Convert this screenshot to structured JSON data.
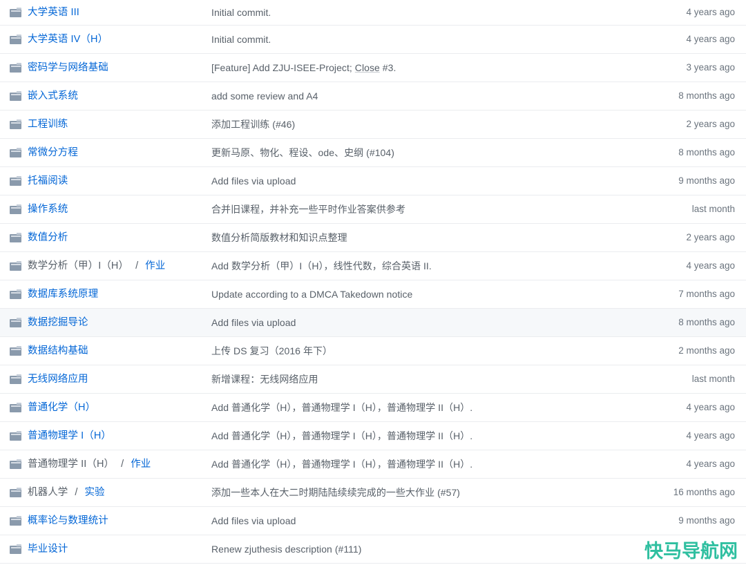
{
  "colors": {
    "link": "#0366d6",
    "muted": "#586069",
    "age": "#6a737d",
    "row_border": "#eaecef",
    "row_hover": "#f6f8fa",
    "folder_icon": "#8a9aac",
    "watermark": "#2fbfa0"
  },
  "watermark": {
    "text": "快马导航网"
  },
  "file_list": {
    "icon": "folder-icon",
    "rows": [
      {
        "parent": "",
        "name": "大学英语 III",
        "message": "Initial commit.",
        "age": "4 years ago",
        "hovered": false,
        "msg_link": ""
      },
      {
        "parent": "",
        "name": "大学英语 IV（H）",
        "message": "Initial commit.",
        "age": "4 years ago",
        "hovered": false,
        "msg_link": ""
      },
      {
        "parent": "",
        "name": "密码学与网络基础",
        "message": "[Feature] Add ZJU-ISEE-Project; Close #3.",
        "message_pre": "[Feature] Add ZJU-ISEE-Project; ",
        "msg_link": "Close",
        "message_post": " #3.",
        "age": "3 years ago",
        "hovered": false
      },
      {
        "parent": "",
        "name": "嵌入式系统",
        "message": "add some review and A4",
        "age": "8 months ago",
        "hovered": false,
        "msg_link": ""
      },
      {
        "parent": "",
        "name": "工程训练",
        "message": "添加工程训练 (#46)",
        "age": "2 years ago",
        "hovered": false,
        "msg_link": ""
      },
      {
        "parent": "",
        "name": "常微分方程",
        "message": "更新马原、物化、程设、ode、史纲 (#104)",
        "age": "8 months ago",
        "hovered": false,
        "msg_link": ""
      },
      {
        "parent": "",
        "name": "托福阅读",
        "message": "Add files via upload",
        "age": "9 months ago",
        "hovered": false,
        "msg_link": ""
      },
      {
        "parent": "",
        "name": "操作系统",
        "message": "合并旧课程，并补充一些平时作业答案供参考",
        "age": "last month",
        "hovered": false,
        "msg_link": ""
      },
      {
        "parent": "",
        "name": "数值分析",
        "message": "数值分析简版教材和知识点整理",
        "age": "2 years ago",
        "hovered": false,
        "msg_link": ""
      },
      {
        "parent": "数学分析（甲）I（H）",
        "name": "作业",
        "message": "Add 数学分析（甲）I（H），线性代数，综合英语 II.",
        "age": "4 years ago",
        "hovered": false,
        "msg_link": ""
      },
      {
        "parent": "",
        "name": "数据库系统原理",
        "message": "Update according to a DMCA Takedown notice",
        "age": "7 months ago",
        "hovered": false,
        "msg_link": ""
      },
      {
        "parent": "",
        "name": "数据挖掘导论",
        "message": "Add files via upload",
        "age": "8 months ago",
        "hovered": true,
        "msg_link": ""
      },
      {
        "parent": "",
        "name": "数据结构基础",
        "message": "上传 DS 复习（2016 年下）",
        "age": "2 months ago",
        "hovered": false,
        "msg_link": ""
      },
      {
        "parent": "",
        "name": "无线网络应用",
        "message": "新增课程：无线网络应用",
        "age": "last month",
        "hovered": false,
        "msg_link": ""
      },
      {
        "parent": "",
        "name": "普通化学（H）",
        "message": "Add 普通化学（H），普通物理学 I（H），普通物理学 II（H）.",
        "age": "4 years ago",
        "hovered": false,
        "msg_link": ""
      },
      {
        "parent": "",
        "name": "普通物理学 I（H）",
        "message": "Add 普通化学（H），普通物理学 I（H），普通物理学 II（H）.",
        "age": "4 years ago",
        "hovered": false,
        "msg_link": ""
      },
      {
        "parent": "普通物理学 II（H）",
        "name": "作业",
        "message": "Add 普通化学（H），普通物理学 I（H），普通物理学 II（H）.",
        "age": "4 years ago",
        "hovered": false,
        "msg_link": ""
      },
      {
        "parent": "机器人学",
        "name": "实验",
        "message": "添加一些本人在大二时期陆陆续续完成的一些大作业 (#57)",
        "age": "16 months ago",
        "hovered": false,
        "msg_link": ""
      },
      {
        "parent": "",
        "name": "概率论与数理统计",
        "message": "Add files via upload",
        "age": "9 months ago",
        "hovered": false,
        "msg_link": ""
      },
      {
        "parent": "",
        "name": "毕业设计",
        "message": "Renew zjuthesis description (#111)",
        "age": "",
        "hovered": false,
        "msg_link": ""
      }
    ]
  }
}
